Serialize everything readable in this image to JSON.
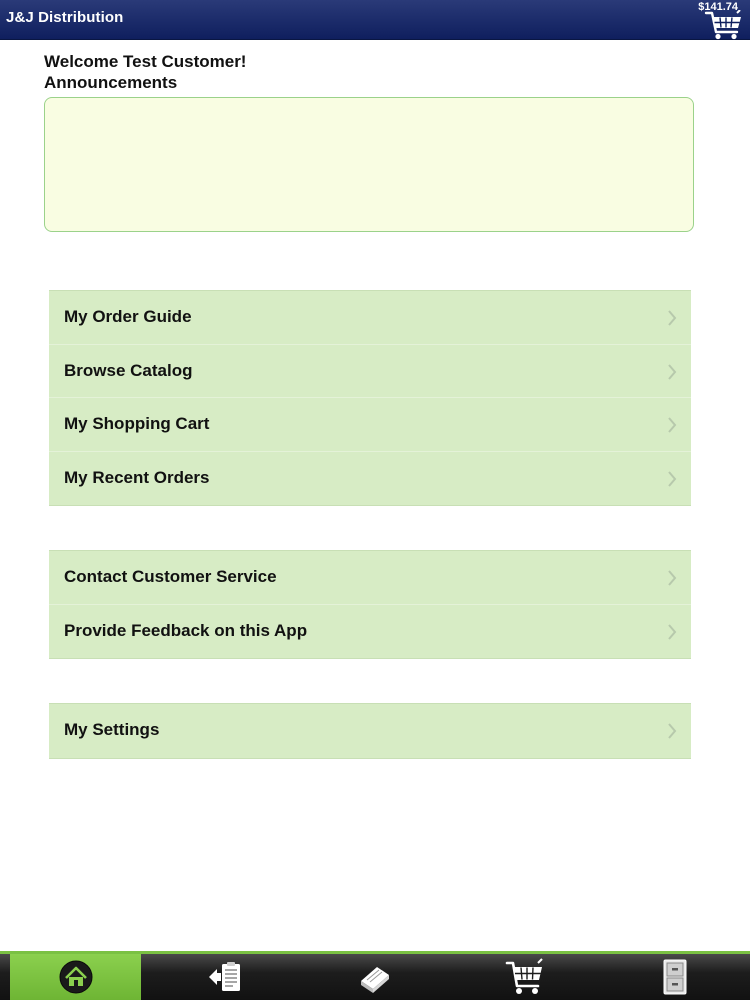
{
  "header": {
    "title": "J&J Distribution",
    "cart_total": "$141.74"
  },
  "welcome": "Welcome Test Customer!",
  "announcements_label": "Announcements",
  "menu_groups": [
    {
      "items": [
        {
          "label": "My Order Guide"
        },
        {
          "label": "Browse Catalog"
        },
        {
          "label": "My Shopping Cart"
        },
        {
          "label": "My Recent Orders"
        }
      ]
    },
    {
      "items": [
        {
          "label": "Contact Customer Service"
        },
        {
          "label": "Provide Feedback on this App"
        }
      ]
    },
    {
      "items": [
        {
          "label": "My Settings"
        }
      ]
    }
  ],
  "tabs": [
    {
      "icon": "home-icon",
      "active": true
    },
    {
      "icon": "order-guide-icon",
      "active": false
    },
    {
      "icon": "catalog-icon",
      "active": false
    },
    {
      "icon": "cart-icon",
      "active": false
    },
    {
      "icon": "recent-orders-icon",
      "active": false
    }
  ],
  "colors": {
    "header": "#0f1f5e",
    "accent_green": "#7ac143",
    "menu_bg": "#d7ecc5",
    "announcement_bg": "#f9fde2"
  }
}
